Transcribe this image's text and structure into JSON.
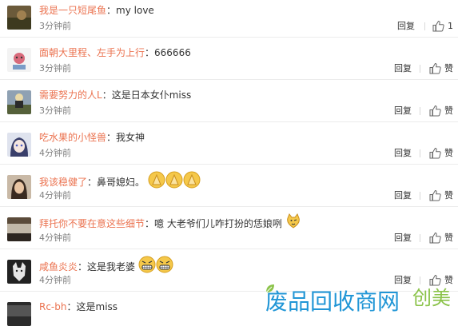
{
  "comments": [
    {
      "username": "我是一只短尾鱼",
      "text": "my love",
      "time": "3分钟前",
      "reply": "回复",
      "like": "1",
      "emoji": 0
    },
    {
      "username": "面朝大里程、左手为上行",
      "text": "666666",
      "time": "3分钟前",
      "reply": "回复",
      "like": "赞",
      "emoji": 0
    },
    {
      "username": "需要努力的人L",
      "text": "这是日本女仆miss",
      "time": "3分钟前",
      "reply": "回复",
      "like": "赞",
      "emoji": 0
    },
    {
      "username": "吃水果的小怪兽",
      "text": "我女神",
      "time": "4分钟前",
      "reply": "回复",
      "like": "赞",
      "emoji": 0
    },
    {
      "username": "我该稳健了",
      "text": "鼻哥媳妇。",
      "time": "4分钟前",
      "reply": "回复",
      "like": "赞",
      "emoji": 3
    },
    {
      "username": "拜托你不要在意这些细节",
      "text": "噫 大老爷们儿咋打扮的恁娘咧",
      "time": "4分钟前",
      "reply": "回复",
      "like": "赞",
      "emoji": 1
    },
    {
      "username": "咸鱼炎炎",
      "text": "这是我老婆",
      "time": "4分钟前",
      "reply": "回复",
      "like": "赞",
      "emoji": 2
    },
    {
      "username": "Rc-bh",
      "text": "这是miss",
      "time": "",
      "reply": "",
      "like": "",
      "emoji": 0
    }
  ],
  "watermark": {
    "main": "废品回收商网",
    "tag": "创美"
  },
  "colors": {
    "username": "#eb7350",
    "time": "#808080",
    "watermark": "#2196d6",
    "watermark_tag": "#8bc34a"
  }
}
